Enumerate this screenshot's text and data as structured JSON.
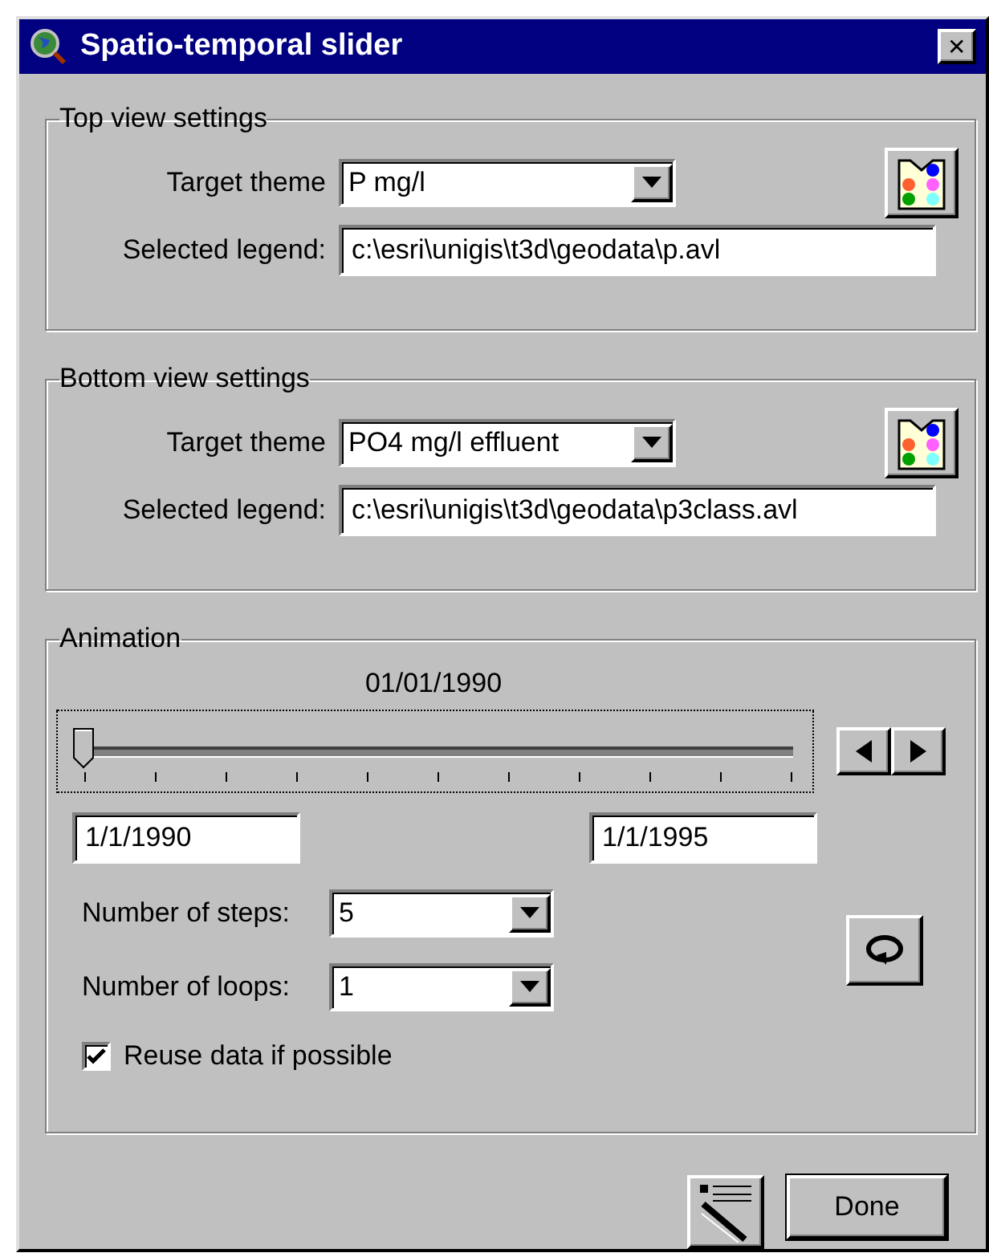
{
  "window": {
    "title": "Spatio-temporal slider",
    "close": "✕"
  },
  "views": [
    {
      "title": "Top view settings",
      "theme_label": "Target theme",
      "theme": "P mg/l",
      "legend_label": "Selected legend:",
      "legend": "c:\\esri\\unigis\\t3d\\geodata\\p.avl"
    },
    {
      "title": "Bottom view settings",
      "theme_label": "Target theme",
      "theme": "PO4 mg/l effluent",
      "legend_label": "Selected legend:",
      "legend": "c:\\esri\\unigis\\t3d\\geodata\\p3class.avl"
    }
  ],
  "animation": {
    "title": "Animation",
    "current_date": "01/01/1990",
    "slider": {
      "level": 0
    },
    "start_date": "1/1/1990",
    "end_date": "1/1/1995",
    "steps_label": "Number of steps:",
    "steps": "5",
    "loops_label": "Number of loops:",
    "loops": "1",
    "reuse": {
      "label": "Reuse data if possible",
      "checked": true
    }
  },
  "buttons": {
    "done": "Done"
  }
}
